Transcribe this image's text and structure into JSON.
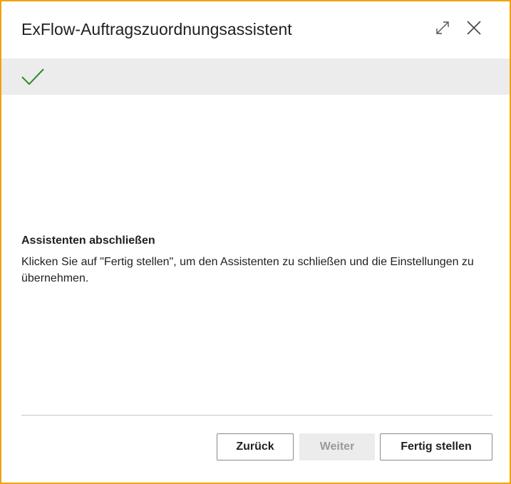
{
  "dialog": {
    "title": "ExFlow-Auftragszuordnungsassistent",
    "header_icons": [
      "expand-icon",
      "close-icon"
    ],
    "accent_border_color": "#f0a30a"
  },
  "step_banner": {
    "icon": "checkmark-icon",
    "icon_color": "#2e8b2e",
    "background": "#ececec"
  },
  "content": {
    "heading": "Assistenten abschließen",
    "text": "Klicken Sie auf \"Fertig stellen\", um den Assistenten zu schließen und die Einstellungen zu übernehmen."
  },
  "footer": {
    "back_label": "Zurück",
    "next_label": "Weiter",
    "next_enabled": false,
    "finish_label": "Fertig stellen"
  }
}
